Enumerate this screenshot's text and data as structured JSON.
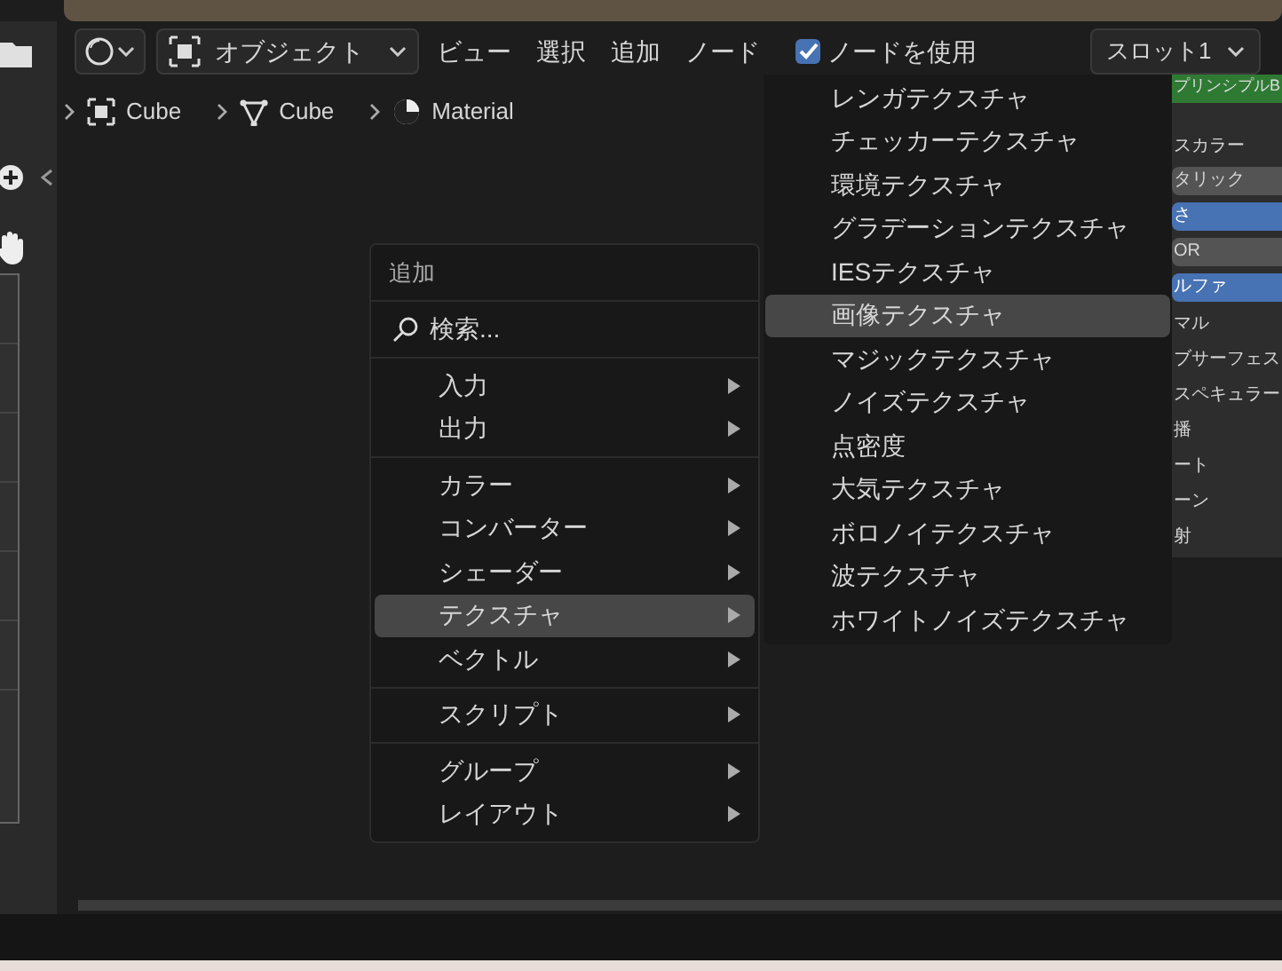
{
  "header": {
    "mode_menu": "オブジェクト",
    "menus": [
      "ビュー",
      "選択",
      "追加",
      "ノード"
    ],
    "use_nodes": {
      "label": "ノードを使用",
      "checked": true
    },
    "slot": "スロット1"
  },
  "breadcrumb": [
    {
      "kind": "object",
      "label": "Cube"
    },
    {
      "kind": "mesh",
      "label": "Cube"
    },
    {
      "kind": "material",
      "label": "Material"
    }
  ],
  "add_menu": {
    "title": "追加",
    "search": "検索...",
    "groups": [
      [
        {
          "label": "入力",
          "selected": false
        },
        {
          "label": "出力",
          "selected": false
        }
      ],
      [
        {
          "label": "カラー",
          "selected": false
        },
        {
          "label": "コンバーター",
          "selected": false
        },
        {
          "label": "シェーダー",
          "selected": false
        },
        {
          "label": "テクスチャ",
          "selected": true
        },
        {
          "label": "ベクトル",
          "selected": false
        }
      ],
      [
        {
          "label": "スクリプト",
          "selected": false
        }
      ],
      [
        {
          "label": "グループ",
          "selected": false
        },
        {
          "label": "レイアウト",
          "selected": false
        }
      ]
    ]
  },
  "texture_menu": [
    {
      "label": "レンガテクスチャ",
      "selected": false
    },
    {
      "label": "チェッカーテクスチャ",
      "selected": false
    },
    {
      "label": "環境テクスチャ",
      "selected": false
    },
    {
      "label": "グラデーションテクスチャ",
      "selected": false
    },
    {
      "label": "IESテクスチャ",
      "selected": false
    },
    {
      "label": "画像テクスチャ",
      "selected": true
    },
    {
      "label": "マジックテクスチャ",
      "selected": false
    },
    {
      "label": "ノイズテクスチャ",
      "selected": false
    },
    {
      "label": "点密度",
      "selected": false
    },
    {
      "label": "大気テクスチャ",
      "selected": false
    },
    {
      "label": "ボロノイテクスチャ",
      "selected": false
    },
    {
      "label": "波テクスチャ",
      "selected": false
    },
    {
      "label": "ホワイトノイズテクスチャ",
      "selected": false
    }
  ],
  "node_panel": [
    {
      "kind": "header",
      "label": "プリンシプルB"
    },
    {
      "kind": "text",
      "label": "スカラー"
    },
    {
      "kind": "field",
      "label": "タリック",
      "highlighted": false
    },
    {
      "kind": "field",
      "label": "さ",
      "highlighted": true
    },
    {
      "kind": "field",
      "label": "OR",
      "highlighted": false
    },
    {
      "kind": "field",
      "label": "ルファ",
      "highlighted": true
    },
    {
      "kind": "text",
      "label": "マル"
    },
    {
      "kind": "text",
      "label": "ブサーフェス"
    },
    {
      "kind": "text",
      "label": "スペキュラー"
    },
    {
      "kind": "text",
      "label": "播"
    },
    {
      "kind": "text",
      "label": "ート"
    },
    {
      "kind": "text",
      "label": "ーン"
    },
    {
      "kind": "text",
      "label": "射"
    }
  ]
}
